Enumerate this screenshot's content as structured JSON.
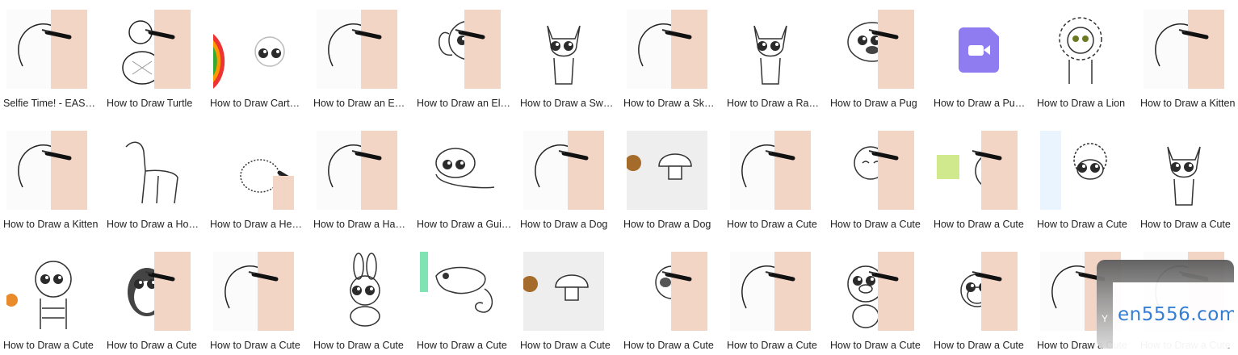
{
  "rows": [
    [
      {
        "label": "Selfie Time! - EASY Drawing",
        "thumb": "hand-drawing-outline",
        "icon": "drawing-thumbnail-icon"
      },
      {
        "label": "How to Draw Turtle",
        "thumb": "turtle-drawing",
        "icon": "drawing-thumbnail-icon"
      },
      {
        "label": "How to Draw Cartoon",
        "thumb": "rainbow-peacock",
        "icon": "drawing-thumbnail-icon"
      },
      {
        "label": "How to Draw an Easy",
        "thumb": "hand-drawing-outline",
        "icon": "drawing-thumbnail-icon"
      },
      {
        "label": "How to Draw an Elephant",
        "thumb": "elephant-drawing",
        "icon": "drawing-thumbnail-icon"
      },
      {
        "label": "How to Draw a Sweet",
        "thumb": "cat-drawing",
        "icon": "drawing-thumbnail-icon"
      },
      {
        "label": "How to Draw a Sketch",
        "thumb": "hand-drawing-outline",
        "icon": "drawing-thumbnail-icon"
      },
      {
        "label": "How to Draw a Raccoon",
        "thumb": "cat-drawing",
        "icon": "drawing-thumbnail-icon"
      },
      {
        "label": "How to Draw a Pug",
        "thumb": "pug-drawing",
        "icon": "drawing-thumbnail-icon"
      },
      {
        "label": "How to Draw a Puppy",
        "thumb": "video-file",
        "icon": "video-file-icon"
      },
      {
        "label": "How to Draw a Lion",
        "thumb": "lion-drawing",
        "icon": "drawing-thumbnail-icon"
      },
      {
        "label": "How to Draw a Kitten",
        "thumb": "hand-drawing-outline",
        "icon": "drawing-thumbnail-icon"
      }
    ],
    [
      {
        "label": "How to Draw a Kitten",
        "thumb": "hand-drawing-outline",
        "icon": "drawing-thumbnail-icon"
      },
      {
        "label": "How to Draw a Horse",
        "thumb": "horse-drawing",
        "icon": "drawing-thumbnail-icon"
      },
      {
        "label": "How to Draw a Hedgehog",
        "thumb": "hedgehog-drawing",
        "icon": "drawing-thumbnail-icon"
      },
      {
        "label": "How to Draw a Hamster",
        "thumb": "hand-drawing-outline",
        "icon": "drawing-thumbnail-icon"
      },
      {
        "label": "How to Draw a Guinea Pig",
        "thumb": "puppy-drawing",
        "icon": "drawing-thumbnail-icon"
      },
      {
        "label": "How to Draw a Dog",
        "thumb": "hand-drawing-outline",
        "icon": "drawing-thumbnail-icon"
      },
      {
        "label": "How to Draw a Dog",
        "thumb": "mushroom-drawing",
        "icon": "drawing-thumbnail-icon"
      },
      {
        "label": "How to Draw a Cute",
        "thumb": "hand-drawing-outline",
        "icon": "drawing-thumbnail-icon"
      },
      {
        "label": "How to Draw a Cute",
        "thumb": "sloth-drawing",
        "icon": "drawing-thumbnail-icon"
      },
      {
        "label": "How to Draw a Cute",
        "thumb": "panda-drawing",
        "icon": "drawing-thumbnail-icon"
      },
      {
        "label": "How to Draw a Cute",
        "thumb": "sheep-drawing",
        "icon": "drawing-thumbnail-icon"
      },
      {
        "label": "How to Draw a Cute",
        "thumb": "cat-drawing",
        "icon": "drawing-thumbnail-icon"
      }
    ],
    [
      {
        "label": "How to Draw a Cute",
        "thumb": "tiger-drawing",
        "icon": "drawing-thumbnail-icon"
      },
      {
        "label": "How to Draw a Cute",
        "thumb": "penguin-drawing",
        "icon": "drawing-thumbnail-icon"
      },
      {
        "label": "How to Draw a Cute",
        "thumb": "hand-drawing-outline",
        "icon": "drawing-thumbnail-icon"
      },
      {
        "label": "How to Draw a Cute",
        "thumb": "bunny-drawing",
        "icon": "drawing-thumbnail-icon"
      },
      {
        "label": "How to Draw a Cute",
        "thumb": "chameleon-drawing",
        "icon": "drawing-thumbnail-icon"
      },
      {
        "label": "How to Draw a Cute",
        "thumb": "mushroom-drawing",
        "icon": "drawing-thumbnail-icon"
      },
      {
        "label": "How to Draw a Cute",
        "thumb": "raccoon-drawing",
        "icon": "drawing-thumbnail-icon"
      },
      {
        "label": "How to Draw a Cute",
        "thumb": "hand-drawing-outline",
        "icon": "drawing-thumbnail-icon"
      },
      {
        "label": "How to Draw a Cute",
        "thumb": "pig-drawing",
        "icon": "drawing-thumbnail-icon"
      },
      {
        "label": "How to Draw a Cute",
        "thumb": "monkey-drawing",
        "icon": "drawing-thumbnail-icon"
      },
      {
        "label": "How to Draw a Cute",
        "thumb": "hand-drawing-outline",
        "icon": "drawing-thumbnail-icon"
      },
      {
        "label": "How to Draw a Cute",
        "thumb": "hand-drawing-outline",
        "icon": "drawing-thumbnail-icon"
      }
    ]
  ],
  "watermark": {
    "text": "en5556.com",
    "corner_letter": "Y"
  },
  "colors": {
    "video_file_icon": "#8f7cf1",
    "watermark_text": "#2a78d2",
    "label_text": "#222222"
  }
}
